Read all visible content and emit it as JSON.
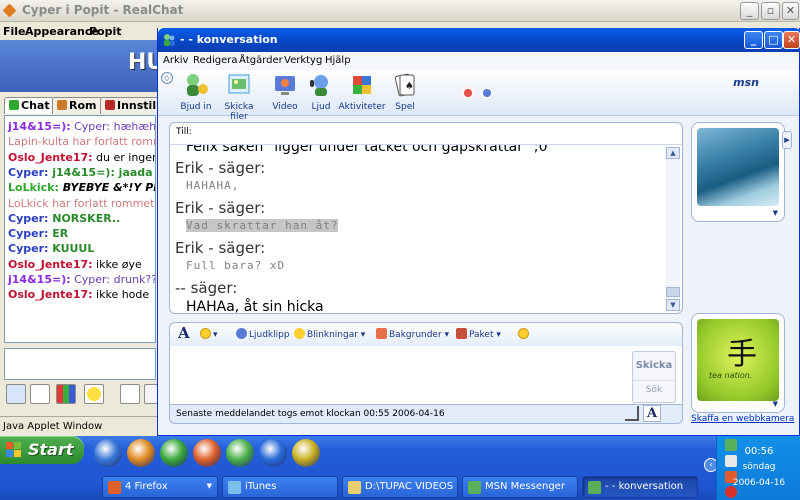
{
  "realchat": {
    "title": "Cyper i Popit - RealChat",
    "menu": [
      "File",
      "Appearance",
      "Popit Chatinfo"
    ],
    "banner_text": "HU",
    "tabs": [
      "Chat",
      "Rom",
      "Innstilli"
    ],
    "chat_lines": [
      {
        "nick": "j14&15=):",
        "text": " Cyper: hæhæh!",
        "nick_color": "#8a2be2",
        "text_color": "#6a3db8",
        "bold_text": false,
        "italic": false
      },
      {
        "nick": "Lapin-kulta har forlatt rommet.",
        "text": "",
        "nick_color": "#d07a7a",
        "text_color": "#d07a7a",
        "bold_text": false,
        "italic": false,
        "system": true
      },
      {
        "nick": "Oslo_Jente17:",
        "text": " du er ingen fine",
        "nick_color": "#c01030",
        "text_color": "#000000",
        "bold_text": false,
        "italic": false
      },
      {
        "nick": "Cyper:",
        "text": " j14&15=): jaada",
        "nick_color": "#2a3fbf",
        "text_color": "#2a8a2a",
        "bold_text": true,
        "italic": false
      },
      {
        "nick": "LoLkick:",
        "text": " BYEBYE &*!Y PEAP",
        "nick_color": "#2fa82f",
        "text_color": "#000000",
        "bold_text": true,
        "italic": true
      },
      {
        "nick": "LoLkick har forlatt rommet.",
        "text": "",
        "nick_color": "#d07a7a",
        "text_color": "#d07a7a",
        "bold_text": false,
        "italic": false,
        "system": true
      },
      {
        "nick": "Cyper:",
        "text": " NORSKER..",
        "nick_color": "#2a3fbf",
        "text_color": "#2a8a2a",
        "bold_text": true,
        "italic": false
      },
      {
        "nick": "Cyper:",
        "text": " ER",
        "nick_color": "#2a3fbf",
        "text_color": "#2a8a2a",
        "bold_text": true,
        "italic": false
      },
      {
        "nick": "Cyper:",
        "text": " KUUUL",
        "nick_color": "#2a3fbf",
        "text_color": "#2a8a2a",
        "bold_text": true,
        "italic": false
      },
      {
        "nick": "Oslo_Jente17:",
        "text": " ikke øye",
        "nick_color": "#c01030",
        "text_color": "#000000",
        "bold_text": false,
        "italic": false
      },
      {
        "nick": "j14&15=):",
        "text": " Cyper: drunk?? haha",
        "nick_color": "#8a2be2",
        "text_color": "#6a3db8",
        "bold_text": false,
        "italic": false
      },
      {
        "nick": "Oslo_Jente17:",
        "text": " ikke hode",
        "nick_color": "#c01030",
        "text_color": "#000000",
        "bold_text": false,
        "italic": false
      }
    ],
    "status": "Java Applet Window"
  },
  "msn": {
    "title": "- - konversation",
    "menu": [
      "Arkiv",
      "Redigera",
      "Åtgärder",
      "Verktyg",
      "Hjälp"
    ],
    "toolbar": [
      {
        "label": "Bjud in",
        "icon": "invite-icon",
        "color": "#3a8a3a"
      },
      {
        "label": "Skicka filer",
        "icon": "send-files-icon",
        "color": "#3aa0d8"
      },
      {
        "label": "Video",
        "icon": "video-icon",
        "color": "#5a7ad8"
      },
      {
        "label": "Ljud",
        "icon": "audio-icon",
        "color": "#3a8a3a"
      },
      {
        "label": "Aktiviteter",
        "icon": "activities-icon",
        "color": "#c8403a"
      },
      {
        "label": "Spel",
        "icon": "games-icon",
        "color": "#d8a020"
      }
    ],
    "logo": "msn",
    "to_label": "Till:",
    "messages": [
      {
        "type": "msg",
        "style": "bold",
        "text": "Felix saken \"ligger under täcket och gapskrattar\" ;0"
      },
      {
        "type": "sender",
        "text": "Erik - säger:"
      },
      {
        "type": "msg",
        "style": "hand",
        "text": "HAHAHA,"
      },
      {
        "type": "sender",
        "text": "Erik - säger:"
      },
      {
        "type": "msg",
        "style": "hand",
        "text": "Vad skrattar han åt?",
        "selected": true
      },
      {
        "type": "sender",
        "text": "Erik - säger:"
      },
      {
        "type": "msg",
        "style": "hand",
        "text": "Full bara? xD"
      },
      {
        "type": "sender",
        "text": "-- säger:"
      },
      {
        "type": "msg",
        "style": "bold",
        "text": "HAHAa, åt sin hicka"
      }
    ],
    "format_bar": {
      "font_label": "A",
      "emoticons_label": "☺",
      "voice_clip": "Ljudklipp",
      "winks": "Blinkningar",
      "backgrounds": "Bakgrunder",
      "packs": "Paket"
    },
    "send_button": "Skicka",
    "search_button": "Sök",
    "status_text": "Senaste meddelandet togs emot klockan 00:55 2006-04-16",
    "avatar_bottom_text": "tea nation.",
    "webcam_link": "Skaffa en webbkamera"
  },
  "taskbar": {
    "start_label": "Start",
    "quicklaunch": [
      {
        "name": "internet-explorer-icon",
        "color": "#3a78d8"
      },
      {
        "name": "media-player-icon",
        "color": "#e08a20"
      },
      {
        "name": "msn-butterfly-icon",
        "color": "#3aa83a"
      },
      {
        "name": "firefox-icon",
        "color": "#e0602a"
      },
      {
        "name": "itunes-icon",
        "color": "#4ab04a"
      },
      {
        "name": "quicktime-icon",
        "color": "#2a6ad8"
      },
      {
        "name": "image-viewer-icon",
        "color": "#c8b020"
      }
    ],
    "tasks": [
      {
        "label": "4 Firefox",
        "icon": "firefox-icon",
        "color": "#e0602a",
        "dropdown": true,
        "active": false
      },
      {
        "label": "iTunes",
        "icon": "itunes-icon",
        "color": "#7ac0e8",
        "dropdown": false,
        "active": false
      },
      {
        "label": "D:\\TUPAC VIDEOS",
        "icon": "folder-icon",
        "color": "#e8d070",
        "dropdown": false,
        "active": false
      },
      {
        "label": "MSN Messenger",
        "icon": "msn-icon",
        "color": "#5ab05a",
        "dropdown": false,
        "active": false
      },
      {
        "label": "- - konversation",
        "icon": "msn-convo-icon",
        "color": "#5ab05a",
        "dropdown": false,
        "active": true
      }
    ],
    "clock": {
      "time": "00:56",
      "day": "söndag",
      "date": "2006-04-16"
    }
  }
}
